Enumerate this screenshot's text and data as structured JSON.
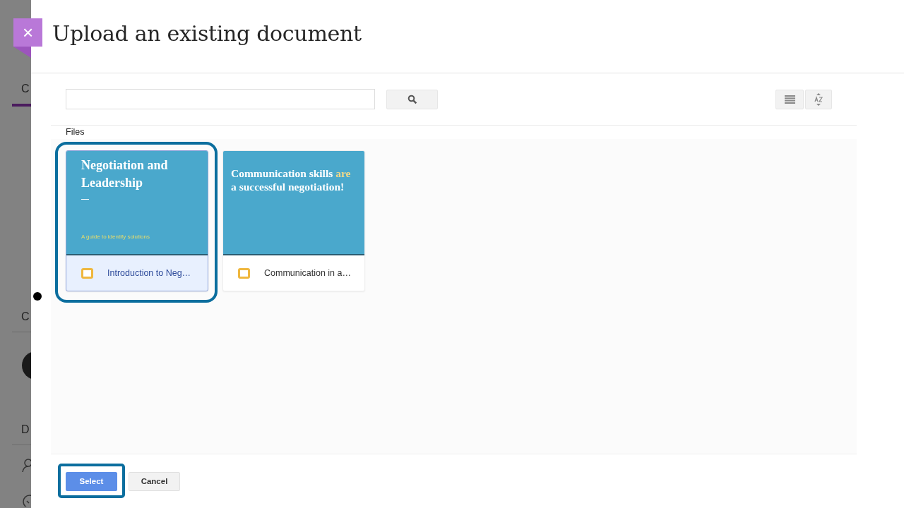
{
  "background_page": {
    "texts": [
      "C",
      "C",
      "D"
    ]
  },
  "dialog": {
    "title": "Upload an existing document",
    "close_label": "×",
    "section_label": "Files",
    "files": [
      {
        "name": "Introduction to Neg…",
        "selected": true,
        "highlighted": true,
        "slide": {
          "title_parts": [
            {
              "text": "Negotiation and Leadership",
              "accent": false
            }
          ],
          "subtitle": "A guide to identify solutions"
        }
      },
      {
        "name": "Communication in a…",
        "selected": false,
        "highlighted": false,
        "slide": {
          "title_parts": [
            {
              "text": "Communication skills ",
              "accent": false
            },
            {
              "text": "are",
              "accent": true
            },
            {
              "text": " a successful negotiation!",
              "accent": false
            }
          ]
        }
      }
    ],
    "buttons": [
      {
        "kind": "primary",
        "label": "Select",
        "highlighted": true
      },
      {
        "kind": "secondary",
        "label": "Cancel",
        "highlighted": false
      }
    ]
  }
}
